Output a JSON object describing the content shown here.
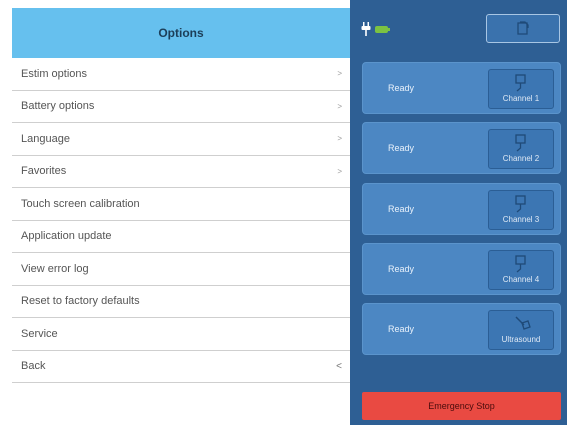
{
  "options_panel": {
    "title": "Options",
    "items": [
      {
        "label": "Estim options",
        "arrow": ">"
      },
      {
        "label": "Battery options",
        "arrow": ">"
      },
      {
        "label": "Language",
        "arrow": ">"
      },
      {
        "label": "Favorites",
        "arrow": ">"
      },
      {
        "label": "Touch screen calibration",
        "arrow": ""
      },
      {
        "label": "Application update",
        "arrow": ""
      },
      {
        "label": "View error log",
        "arrow": ""
      },
      {
        "label": "Reset to factory defaults",
        "arrow": ""
      },
      {
        "label": "Service",
        "arrow": ""
      },
      {
        "label": "Back",
        "arrow": "<"
      }
    ]
  },
  "status_bar": {
    "plug_icon": "power-plug-icon",
    "battery_icon": "battery-icon",
    "battery_color": "#7cc242",
    "home_icon": "home-screen-icon"
  },
  "channels": [
    {
      "status": "Ready",
      "label": "Channel 1",
      "icon": "electrode-icon"
    },
    {
      "status": "Ready",
      "label": "Channel 2",
      "icon": "electrode-icon"
    },
    {
      "status": "Ready",
      "label": "Channel 3",
      "icon": "electrode-icon"
    },
    {
      "status": "Ready",
      "label": "Channel 4",
      "icon": "electrode-icon"
    },
    {
      "status": "Ready",
      "label": "Ultrasound",
      "icon": "ultrasound-probe-icon"
    }
  ],
  "emergency_stop": {
    "label": "Emergency Stop",
    "color": "#e94a42"
  },
  "colors": {
    "header": "#66c0ee",
    "panel": "#2e5f94",
    "card": "#4c87c3",
    "channel_button": "#3c76b3"
  }
}
